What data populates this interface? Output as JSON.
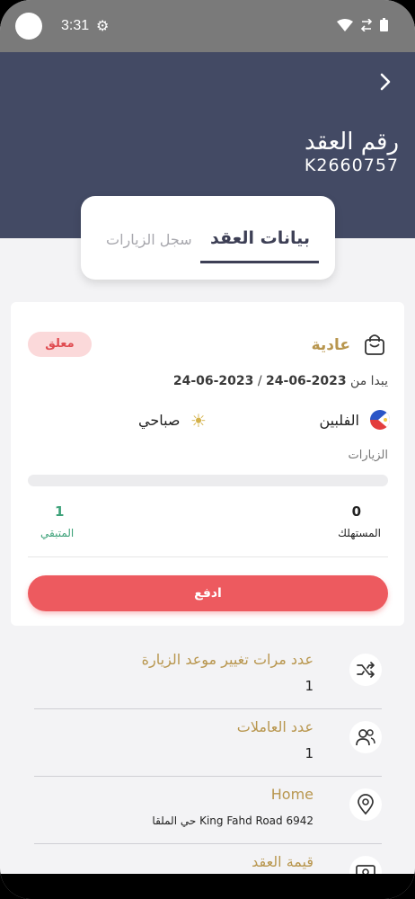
{
  "status_bar": {
    "time": "3:31"
  },
  "header": {
    "title": "رقم العقد",
    "contract_number": "K2660757"
  },
  "tabs": [
    {
      "label": "بيانات العقد",
      "active": true
    },
    {
      "label": "سجل الزيارات",
      "active": false
    }
  ],
  "card": {
    "status_badge": "معلق",
    "contract_type": "عادية",
    "date_prefix": "يبدا من",
    "start_date": "2023-06-24",
    "date_separator": "/",
    "end_date": "2023-06-24",
    "country": "الفلبين",
    "shift": "صباحي",
    "visits_label": "الزيارات",
    "visits_progress": 0,
    "consumed_value": "0",
    "consumed_label": "المستهلك",
    "remaining_value": "1",
    "remaining_label": "المتبقي",
    "pay_button": "ادفع"
  },
  "info": [
    {
      "label": "عدد مرات تغيير موعد الزيارة",
      "value": "1",
      "icon": "shuffle-icon"
    },
    {
      "label": "عدد العاملات",
      "value": "1",
      "icon": "users-icon"
    },
    {
      "label": "Home",
      "value": "King Fahd Road 6942 حي الملقا",
      "icon": "location-pin-icon"
    },
    {
      "label": "قيمة العقد",
      "value": "",
      "icon": "money-icon"
    }
  ],
  "colors": {
    "header_bg": "#434a64",
    "gold": "#b8964e",
    "pay": "#ed5a5f",
    "green": "#3ea27a"
  }
}
